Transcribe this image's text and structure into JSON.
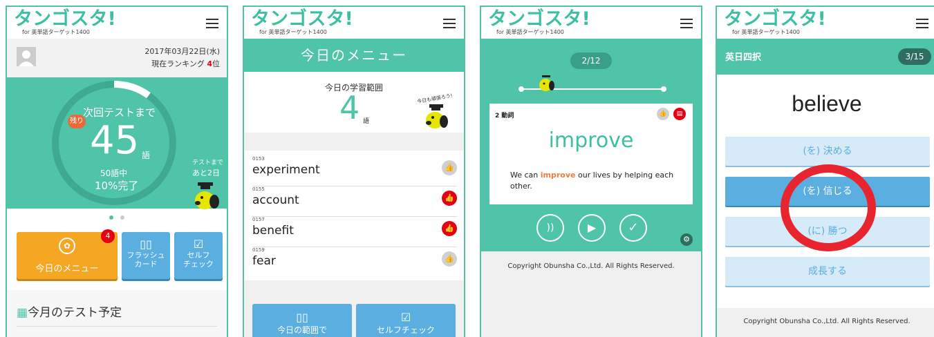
{
  "app": {
    "logo": "タンゴスタ!",
    "logo_sub": "for 英単語ターゲット1400"
  },
  "s1": {
    "date": "2017年03月22日(水)",
    "rank_prefix": "現在ランキング",
    "rank_num": "4",
    "rank_suffix": "位",
    "until_test": "次回テストまで",
    "remain_badge": "残り",
    "remain_count": "45",
    "remain_unit": "語",
    "total": "50語中",
    "percent": "10%完了",
    "progress": 0.1,
    "test_days_1": "テストまで",
    "test_days_2": "あと2日",
    "menu_label": "今日のメニュー",
    "menu_badge": "4",
    "flash_label": "フラッシュ\nカード",
    "self_label": "セルフ\nチェック",
    "schedule_title": "今月のテスト予定"
  },
  "s2": {
    "title": "今日のメニュー",
    "range_label": "今日の学習範囲",
    "range_count": "4",
    "range_unit": "語",
    "cheer": "今日も頑張ろう!",
    "words": [
      {
        "num": "0153",
        "word": "experiment",
        "flag": false
      },
      {
        "num": "0155",
        "word": "account",
        "flag": true
      },
      {
        "num": "0157",
        "word": "benefit",
        "flag": true
      },
      {
        "num": "0159",
        "word": "fear",
        "flag": false
      }
    ],
    "btn_range": "今日の範囲で",
    "btn_self": "セルフチェック"
  },
  "s3": {
    "counter": "2/12",
    "pos": "2 動詞",
    "word": "improve",
    "sentence_pre": "We can ",
    "sentence_key": "improve",
    "sentence_post": " our lives by helping each other.",
    "copyright": "Copyright Obunsha Co.,Ltd. All Rights Reserved."
  },
  "s4": {
    "mode": "英日四択",
    "counter": "3/15",
    "word": "believe",
    "choices": [
      "(を) 決める",
      "(を) 信じる",
      "(に) 勝つ",
      "成長する"
    ],
    "copyright": "Copyright Obunsha Co.,Ltd. All Rights Reserved."
  },
  "colors": {
    "teal": "#4fc4a9",
    "orange": "#f5a623",
    "blue": "#5aaee0",
    "red": "#e60012"
  }
}
